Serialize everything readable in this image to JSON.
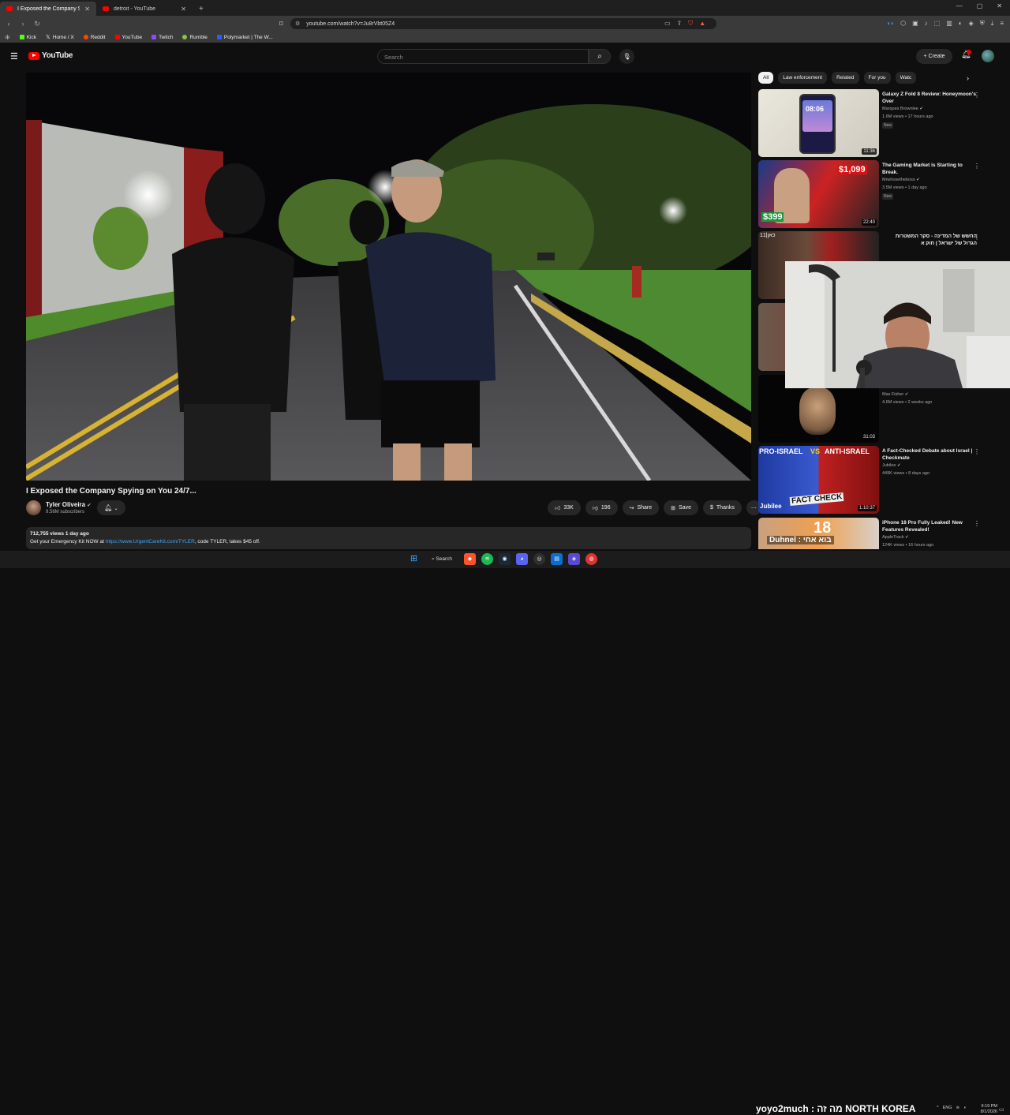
{
  "browser": {
    "tabs": [
      {
        "title": "I Exposed the Company Spyi",
        "active": true
      },
      {
        "title": "detroit - YouTube",
        "active": false
      }
    ],
    "url": "youtube.com/watch?v=Ju8rVbt05Z4",
    "bookmarks": [
      {
        "label": "Kick",
        "color": "#53fc18"
      },
      {
        "label": "Home / X",
        "color": "#ffffff"
      },
      {
        "label": "Reddit",
        "color": "#ff4500"
      },
      {
        "label": "YouTube",
        "color": "#ff0000"
      },
      {
        "label": "Twitch",
        "color": "#9146ff"
      },
      {
        "label": "Rumble",
        "color": "#85c742"
      },
      {
        "label": "Polymarket | The W...",
        "color": "#2e5cff"
      }
    ]
  },
  "header": {
    "logo": "YouTube",
    "search_placeholder": "Search",
    "create_label": "Create"
  },
  "video": {
    "title": "I Exposed the Company Spying on You 24/7...",
    "channel": "Tyler Oliveira",
    "subscribers": "9.56M subscribers",
    "likes": "33K",
    "dislikes": "196",
    "share_label": "Share",
    "save_label": "Save",
    "thanks_label": "Thanks",
    "views_date": "712,755 views  1 day ago",
    "description_prefix": "Get your Emergency Kit NOW at ",
    "description_link": "https://www.UrgentCareKit.com/TYLER",
    "description_suffix": ", code TYLER, takes $45 off."
  },
  "chips": [
    "All",
    "Law enforcement",
    "Related",
    "For you",
    "Watc"
  ],
  "recommendations": [
    {
      "title": "Galaxy Z Fold 8 Review: Honeymoon's Over",
      "channel": "Marques Brownlee",
      "views": "1.6M views • 17 hours ago",
      "badge": "New",
      "duration": "11:36",
      "clock": "08:06"
    },
    {
      "title": "The Gaming Market is Starting to Break.",
      "channel": "Mrwhosetheboss",
      "views": "3.5M views • 1 day ago",
      "badge": "New",
      "duration": "22:40",
      "price_top": "$1,099",
      "price_bottom": "$399"
    },
    {
      "title": "החשש של המדינה - סקר המשטרות הגדול של ישראל | חוק א",
      "channel": "",
      "views": "",
      "duration": "",
      "top_label": "כאן|11"
    },
    {
      "title": "",
      "channel": "",
      "views": "",
      "duration": ""
    },
    {
      "title": "",
      "channel": "Max Fisher",
      "views": "4.6M views • 2 weeks ago",
      "duration": "31:03"
    },
    {
      "title": "A Fact-Checked Debate about Israel | Checkmate",
      "channel": "Jubilee",
      "views": "449K views • 8 days ago",
      "duration": "1:10:37",
      "thumb_left": "PRO-ISRAEL",
      "thumb_vs": "VS",
      "thumb_right": "ANTI-ISRAEL",
      "thumb_bottom": "FACT CHECK",
      "thumb_brand": "Jubilee"
    },
    {
      "title": "iPhone 18 Pro Fully Leaked! New Features Revealed!",
      "channel": "AppleTrack",
      "views": "124K views • 16 hours ago",
      "duration": "",
      "thumb_number": "18"
    }
  ],
  "stream_overlay": "yoyo2much : מה זה NORTH KOREA",
  "partial_overlay": "Duhnel : בוא אחי",
  "taskbar": {
    "search_label": "Search",
    "lang": "ENG",
    "time": "9:19 PM",
    "date": "8/1/2026"
  }
}
